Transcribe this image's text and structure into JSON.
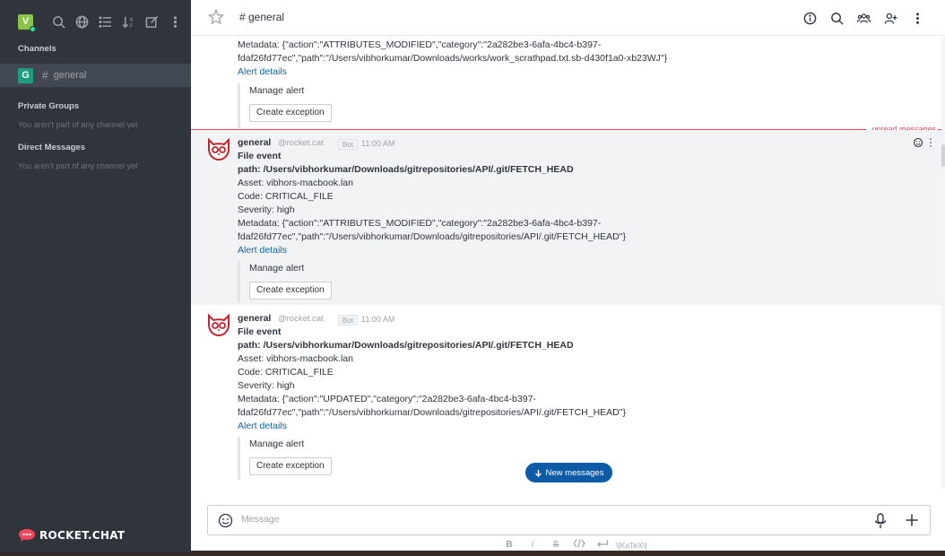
{
  "sidebar": {
    "user_initial": "V",
    "channels_heading": "Channels",
    "channel": {
      "badge": "G",
      "name": "general"
    },
    "private_heading": "Private Groups",
    "private_note": "You aren't part of any channel yet",
    "direct_heading": "Direct Messages",
    "direct_note": "You aren't part of any channel yet",
    "logo_text": "ROCKET.CHAT"
  },
  "header": {
    "title": "# general",
    "icons": [
      "star-icon",
      "info-icon",
      "search-icon",
      "members-icon",
      "add-user-icon",
      "kebab-icon"
    ]
  },
  "messages": {
    "top_partial": {
      "metadata_line1": "Metadata: {\"action\":\"ATTRIBUTES_MODIFIED\",\"category\":\"2a282be3-6afa-4bc4-b397-",
      "metadata_line2": "fdaf26fd77ec\",\"path\":\"/Users/vibhorkumar/Downloads/works/work_scrathpad.txt.sb-d430f1a0-xb23WJ\"}",
      "alert_details": "Alert details",
      "manage_alert": "Manage alert",
      "create_exception": "Create exception"
    },
    "unread_label": "unread messages",
    "items": [
      {
        "username": "general",
        "handle": "@rocket.cat",
        "bot": "Bot",
        "time": "11:00 AM",
        "title": "File event",
        "path": "path: /Users/vibhorkumar/Downloads/gitrepositories/API/.git/FETCH_HEAD",
        "asset": "Asset: vibhors-macbook.lan",
        "code": "Code: CRITICAL_FILE",
        "severity": "Severity: high",
        "metadata_line1": "Metadata: {\"action\":\"ATTRIBUTES_MODIFIED\",\"category\":\"2a282be3-6afa-4bc4-b397-",
        "metadata_line2": "fdaf26fd77ec\",\"path\":\"/Users/vibhorkumar/Downloads/gitrepositories/API/.git/FETCH_HEAD\"}",
        "alert_details": "Alert details",
        "manage_alert": "Manage alert",
        "create_exception": "Create exception"
      },
      {
        "username": "general",
        "handle": "@rocket.cat",
        "bot": "Bot",
        "time": "11:00 AM",
        "title": "File event",
        "path": "path: /Users/vibhorkumar/Downloads/gitrepositories/API/.git/FETCH_HEAD",
        "asset": "Asset: vibhors-macbook.lan",
        "code": "Code: CRITICAL_FILE",
        "severity": "Severity: high",
        "metadata_line1": "Metadata: {\"action\":\"UPDATED\",\"category\":\"2a282be3-6afa-4bc4-b397-",
        "metadata_line2": "fdaf26fd77ec\",\"path\":\"/Users/vibhorkumar/Downloads/gitrepositories/API/.git/FETCH_HEAD\"}",
        "alert_details": "Alert details",
        "manage_alert": "Manage alert",
        "create_exception": "Create exception"
      }
    ]
  },
  "new_messages_button": "New messages",
  "composer": {
    "placeholder": "Message",
    "toolbar": {
      "bold": "B",
      "italic": "i",
      "strike": "S",
      "katex": "\\[KaTeX\\]"
    }
  },
  "colors": {
    "sidebar_bg": "#2f343d",
    "accent": "#0d5aa7",
    "unread": "#f5455c",
    "channel_badge": "#1d9d80",
    "user_avatar": "#8bc34a"
  }
}
